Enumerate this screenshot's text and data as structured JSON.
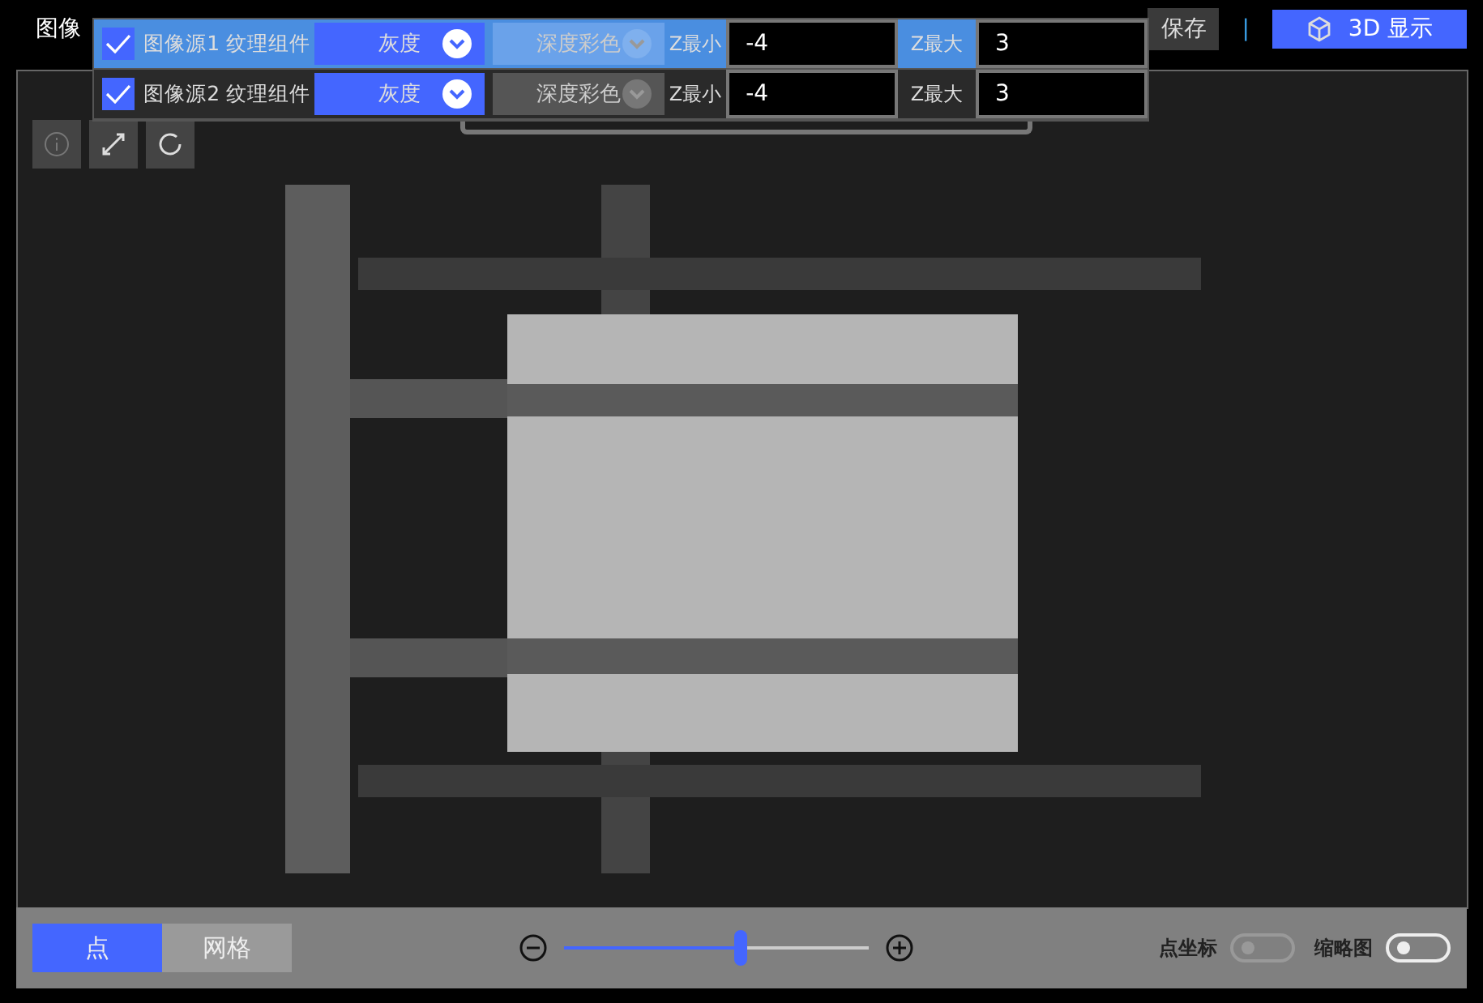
{
  "header": {
    "title": "图像",
    "save_button": "保存",
    "separator": "|",
    "display_button": "3D 显示"
  },
  "sources": [
    {
      "checked": true,
      "selected": true,
      "name": "图像源1 纹理组件",
      "gray_option": "灰度",
      "color_option": "深度彩色",
      "zmin_label": "Z最小",
      "zmin": "-4",
      "zmax_label": "Z最大",
      "zmax": "3"
    },
    {
      "checked": true,
      "selected": false,
      "name": "图像源2 纹理组件",
      "gray_option": "灰度",
      "color_option": "深度彩色",
      "zmin_label": "Z最小",
      "zmin": "-4",
      "zmax_label": "Z最大",
      "zmax": "3"
    }
  ],
  "bottom_bar": {
    "modes": [
      {
        "label": "点",
        "selected": true
      },
      {
        "label": "网格",
        "selected": false
      }
    ],
    "zoom": {
      "level": 0.58
    },
    "toggles": [
      {
        "label": "点坐标",
        "on": false,
        "disabled": true
      },
      {
        "label": "缩略图",
        "on": false,
        "disabled": false
      }
    ]
  }
}
